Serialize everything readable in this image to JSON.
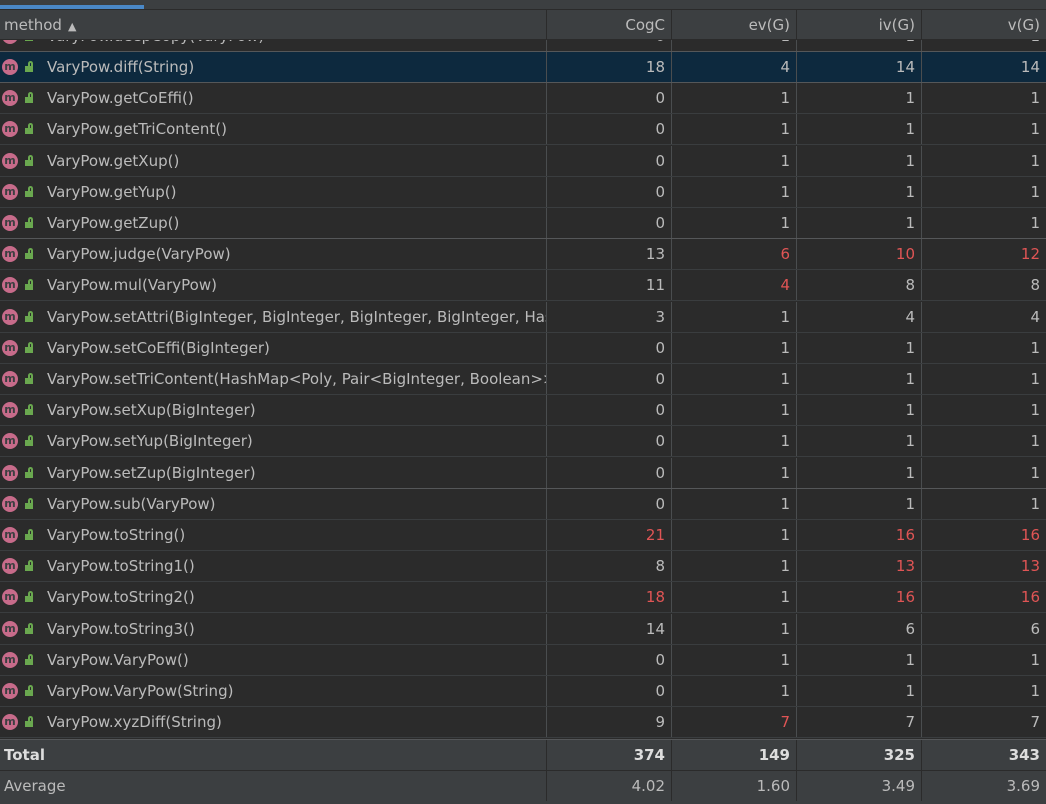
{
  "header": {
    "method": "method",
    "sort_indicator": "▲",
    "cogc": "CogC",
    "evg": "ev(G)",
    "ivg": "iv(G)",
    "vg": "v(G)"
  },
  "partial_row": {
    "method": "VaryPow.deepCopy(VaryPow)",
    "cogc": "0",
    "evg": "1",
    "ivg": "1",
    "vg": "1"
  },
  "rows": [
    {
      "method": "VaryPow.diff(String)",
      "cogc": "18",
      "evg": "4",
      "ivg": "14",
      "vg": "14",
      "selected": true,
      "red": []
    },
    {
      "method": "VaryPow.getCoEffi()",
      "cogc": "0",
      "evg": "1",
      "ivg": "1",
      "vg": "1",
      "red": []
    },
    {
      "method": "VaryPow.getTriContent()",
      "cogc": "0",
      "evg": "1",
      "ivg": "1",
      "vg": "1",
      "red": []
    },
    {
      "method": "VaryPow.getXup()",
      "cogc": "0",
      "evg": "1",
      "ivg": "1",
      "vg": "1",
      "red": []
    },
    {
      "method": "VaryPow.getYup()",
      "cogc": "0",
      "evg": "1",
      "ivg": "1",
      "vg": "1",
      "red": []
    },
    {
      "method": "VaryPow.getZup()",
      "cogc": "0",
      "evg": "1",
      "ivg": "1",
      "vg": "1",
      "red": []
    },
    {
      "method": "VaryPow.judge(VaryPow)",
      "cogc": "13",
      "evg": "6",
      "ivg": "10",
      "vg": "12",
      "red": [
        "evg",
        "ivg",
        "vg"
      ]
    },
    {
      "method": "VaryPow.mul(VaryPow)",
      "cogc": "11",
      "evg": "4",
      "ivg": "8",
      "vg": "8",
      "red": [
        "evg"
      ]
    },
    {
      "method": "VaryPow.setAttri(BigInteger, BigInteger, BigInteger, BigInteger, HashMap<Poly, Pair<BigInteger, Boolean>>)",
      "cogc": "3",
      "evg": "1",
      "ivg": "4",
      "vg": "4",
      "red": []
    },
    {
      "method": "VaryPow.setCoEffi(BigInteger)",
      "cogc": "0",
      "evg": "1",
      "ivg": "1",
      "vg": "1",
      "red": []
    },
    {
      "method": "VaryPow.setTriContent(HashMap<Poly, Pair<BigInteger, Boolean>>)",
      "cogc": "0",
      "evg": "1",
      "ivg": "1",
      "vg": "1",
      "red": []
    },
    {
      "method": "VaryPow.setXup(BigInteger)",
      "cogc": "0",
      "evg": "1",
      "ivg": "1",
      "vg": "1",
      "red": []
    },
    {
      "method": "VaryPow.setYup(BigInteger)",
      "cogc": "0",
      "evg": "1",
      "ivg": "1",
      "vg": "1",
      "red": []
    },
    {
      "method": "VaryPow.setZup(BigInteger)",
      "cogc": "0",
      "evg": "1",
      "ivg": "1",
      "vg": "1",
      "red": []
    },
    {
      "method": "VaryPow.sub(VaryPow)",
      "cogc": "0",
      "evg": "1",
      "ivg": "1",
      "vg": "1",
      "red": []
    },
    {
      "method": "VaryPow.toString()",
      "cogc": "21",
      "evg": "1",
      "ivg": "16",
      "vg": "16",
      "red": [
        "cogc",
        "ivg",
        "vg"
      ]
    },
    {
      "method": "VaryPow.toString1()",
      "cogc": "8",
      "evg": "1",
      "ivg": "13",
      "vg": "13",
      "red": [
        "ivg",
        "vg"
      ]
    },
    {
      "method": "VaryPow.toString2()",
      "cogc": "18",
      "evg": "1",
      "ivg": "16",
      "vg": "16",
      "red": [
        "cogc",
        "ivg",
        "vg"
      ]
    },
    {
      "method": "VaryPow.toString3()",
      "cogc": "14",
      "evg": "1",
      "ivg": "6",
      "vg": "6",
      "red": []
    },
    {
      "method": "VaryPow.VaryPow()",
      "cogc": "0",
      "evg": "1",
      "ivg": "1",
      "vg": "1",
      "red": []
    },
    {
      "method": "VaryPow.VaryPow(String)",
      "cogc": "0",
      "evg": "1",
      "ivg": "1",
      "vg": "1",
      "red": []
    },
    {
      "method": "VaryPow.xyzDiff(String)",
      "cogc": "9",
      "evg": "7",
      "ivg": "7",
      "vg": "7",
      "red": [
        "evg"
      ]
    }
  ],
  "total": {
    "label": "Total",
    "cogc": "374",
    "evg": "149",
    "ivg": "325",
    "vg": "343"
  },
  "average": {
    "label": "Average",
    "cogc": "4.02",
    "evg": "1.60",
    "ivg": "3.49",
    "vg": "3.69"
  },
  "icons": {
    "method": "method-icon",
    "access": "public-lock-icon"
  },
  "colors": {
    "selected_row": "#0d293e",
    "warning_value": "#e05555",
    "method_icon": "#c76b8a",
    "public_lock": "#6aa84f",
    "tab_accent": "#4a88c7"
  }
}
